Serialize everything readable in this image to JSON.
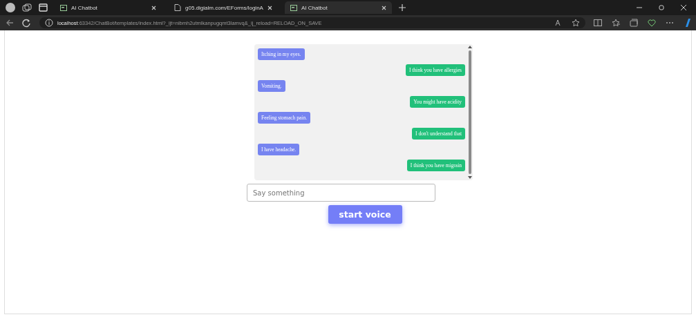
{
  "tabs": [
    {
      "label": "AI Chatbot",
      "selected": false,
      "kind": "app"
    },
    {
      "label": "g05.digialm.com/EForms/loginA",
      "selected": false,
      "kind": "page"
    },
    {
      "label": "AI Chatbot",
      "selected": true,
      "kind": "app"
    }
  ],
  "address_bar": {
    "host": "localhost",
    "path": ":63342/ChatBot/templates/index.html?_ijt=nibmh2utmlkanpugqmt3lamvq&_ij_reload=RELOAD_ON_SAVE"
  },
  "messages": [
    {
      "kind": "user",
      "text": "Itching in my eyes."
    },
    {
      "kind": "bot",
      "text": "I think you have allergies"
    },
    {
      "kind": "user",
      "text": "Vomiting."
    },
    {
      "kind": "bot",
      "text": "You might have acidity"
    },
    {
      "kind": "user",
      "text": "Feeling stomach pain."
    },
    {
      "kind": "bot",
      "text": "I don't understand that"
    },
    {
      "kind": "user",
      "text": "I have headache."
    },
    {
      "kind": "bot",
      "text": "I think you have migrain"
    }
  ],
  "input": {
    "placeholder": "Say something"
  },
  "button": {
    "label": "start voice"
  }
}
